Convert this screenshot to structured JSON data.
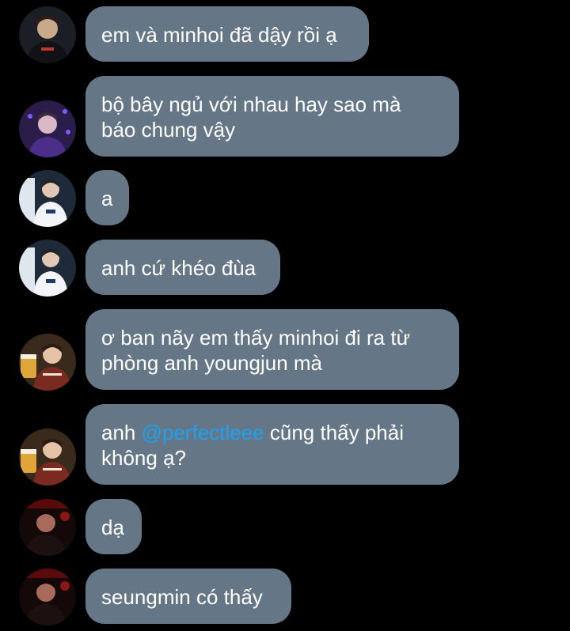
{
  "colors": {
    "background": "#000000",
    "bubble": "#657786",
    "text": "#ffffff",
    "mention": "#1da1f2"
  },
  "messages": [
    {
      "avatar": "avatar-a",
      "lines": [
        "em và minhoi đã dậy rồi ạ"
      ]
    },
    {
      "avatar": "avatar-b",
      "lines": [
        "bộ bây ngủ với nhau hay sao mà",
        "báo chung vậy"
      ]
    },
    {
      "avatar": "avatar-c",
      "lines": [
        "a"
      ]
    },
    {
      "avatar": "avatar-c",
      "lines": [
        "anh cứ khéo đùa"
      ]
    },
    {
      "avatar": "avatar-d",
      "lines": [
        "ơ ban nãy em thấy minhoi đi ra từ",
        "phòng anh youngjun mà"
      ]
    },
    {
      "avatar": "avatar-d",
      "line1_prefix": "anh ",
      "mention": "@perfectleee",
      "line1_suffix": " cũng thấy phải",
      "line2": "không ạ?"
    },
    {
      "avatar": "avatar-e",
      "lines": [
        "dạ"
      ]
    },
    {
      "avatar": "avatar-e",
      "lines": [
        "seungmin có thấy"
      ]
    }
  ]
}
